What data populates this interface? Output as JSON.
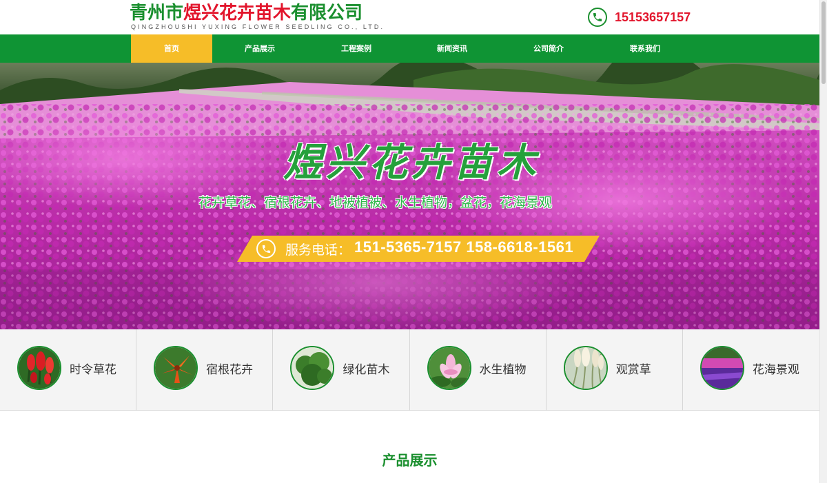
{
  "header": {
    "company_name_prefix": "青州市",
    "company_name_mid": "煜兴花卉苗木",
    "company_name_suffix": "有限公司",
    "company_name_en": "QINGZHOUSHI YUXING FLOWER SEEDLING CO., LTD.",
    "phone": "15153657157"
  },
  "nav": {
    "items": [
      {
        "label": "首页",
        "active": true
      },
      {
        "label": "产品展示"
      },
      {
        "label": "工程案例"
      },
      {
        "label": "新闻资讯"
      },
      {
        "label": "公司简介"
      },
      {
        "label": "联系我们"
      }
    ]
  },
  "banner": {
    "title": "煜兴花卉苗木",
    "subtitle": "花卉草花、宿根花卉、地被植被、水生植物，盆花，花海景观",
    "hotline_label": "服务电话：",
    "hotline_numbers": "151-5365-7157   158-6618-1561"
  },
  "categories": [
    {
      "label": "时令草花",
      "icon": "red-salvia-flower"
    },
    {
      "label": "宿根花卉",
      "icon": "orange-lily-flower"
    },
    {
      "label": "绿化苗木",
      "icon": "green-shrub"
    },
    {
      "label": "水生植物",
      "icon": "lotus-flower"
    },
    {
      "label": "观赏草",
      "icon": "pampas-grass"
    },
    {
      "label": "花海景观",
      "icon": "purple-flower-field"
    }
  ],
  "section": {
    "title": "产品展示"
  },
  "colors": {
    "brand_green": "#0f9434",
    "active_yellow": "#f6bd28",
    "accent_red": "#e2152c"
  }
}
